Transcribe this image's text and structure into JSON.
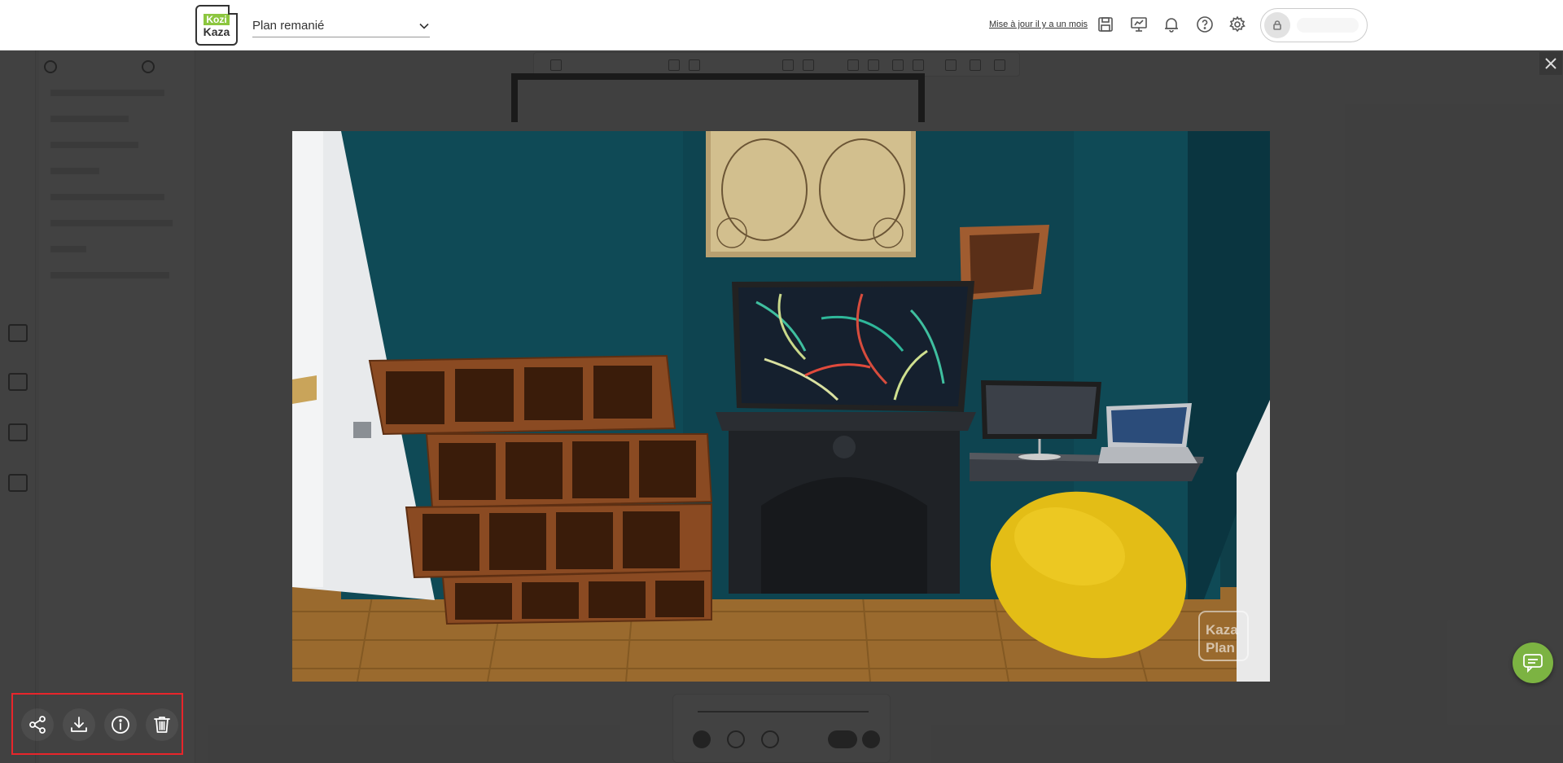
{
  "header": {
    "logo_top": "Kozi",
    "logo_bottom": "Kaza",
    "plan_name": "Plan remanié",
    "updated_link": "Mise à jour il y a un mois",
    "icons": [
      "save-icon",
      "presentation-icon",
      "bell-icon",
      "help-icon",
      "gear-icon",
      "lock-icon"
    ]
  },
  "viewer": {
    "watermark_top": "Kaza",
    "watermark_bottom": "Plan",
    "actions": [
      {
        "name": "share",
        "icon": "share-icon"
      },
      {
        "name": "download",
        "icon": "download-icon"
      },
      {
        "name": "info",
        "icon": "info-icon"
      },
      {
        "name": "delete",
        "icon": "trash-icon"
      }
    ],
    "highlight_color": "#e8252b"
  },
  "chat": {
    "icon": "chat-icon",
    "color": "#7cb342"
  }
}
